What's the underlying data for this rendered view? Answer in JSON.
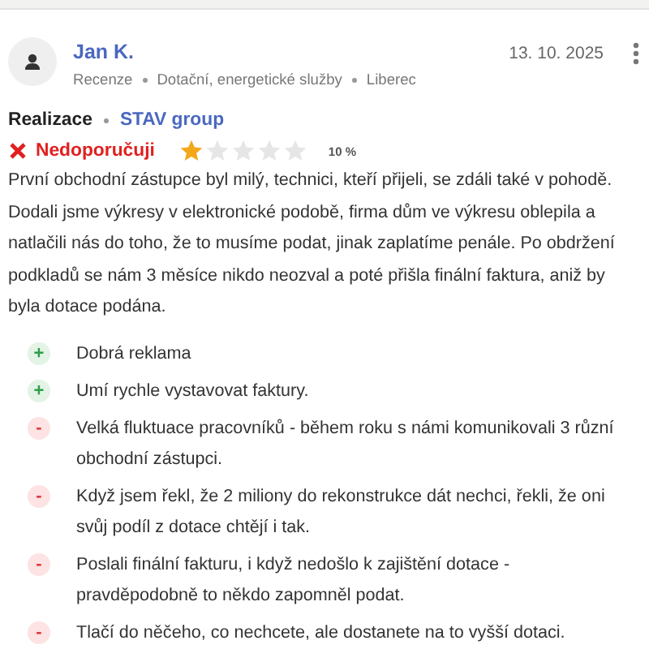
{
  "review": {
    "author": "Jan K.",
    "meta": [
      "Recenze",
      "Dotační, energetické služby",
      "Liberec"
    ],
    "date": "13. 10. 2025"
  },
  "realization": {
    "label": "Realizace",
    "company": "STAV group"
  },
  "verdict": {
    "kind": "negative",
    "label": "Nedoporučuji"
  },
  "rating": {
    "stars": 1,
    "percent": "10 %"
  },
  "text": "První obchodní zástupce byl milý, technici, kteří přijeli, se zdáli také v pohodě. Dodali jsme výkresy v elektronické podobě, firma dům ve výkresu oblepila a natlačili nás do toho, že to musíme podat, jinak zaplatíme penále. Po obdržení podkladů se nám 3 měsíce nikdo neozval a poté přišla finální faktura, aniž by byla dotace podána.",
  "points": [
    {
      "kind": "pro",
      "sign": "+",
      "text": "Dobrá reklama"
    },
    {
      "kind": "pro",
      "sign": "+",
      "text": "Umí rychle vystavovat faktury."
    },
    {
      "kind": "con",
      "sign": "-",
      "text": "Velká fluktuace pracovníků - během roku s námi komunikovali 3 různí obchodní zástupci."
    },
    {
      "kind": "con",
      "sign": "-",
      "text": "Když jsem řekl, že 2 miliony do rekonstrukce dát nechci, řekli, že oni svůj podíl z dotace chtějí i tak."
    },
    {
      "kind": "con",
      "sign": "-",
      "text": "Poslali finální fakturu, i když nedošlo k zajištění dotace - pravděpodobně to někdo zapomněl podat."
    },
    {
      "kind": "con",
      "sign": "-",
      "text": "Tlačí do něčeho, co nechcete, ale dostanete na to vyšší dotaci."
    }
  ]
}
